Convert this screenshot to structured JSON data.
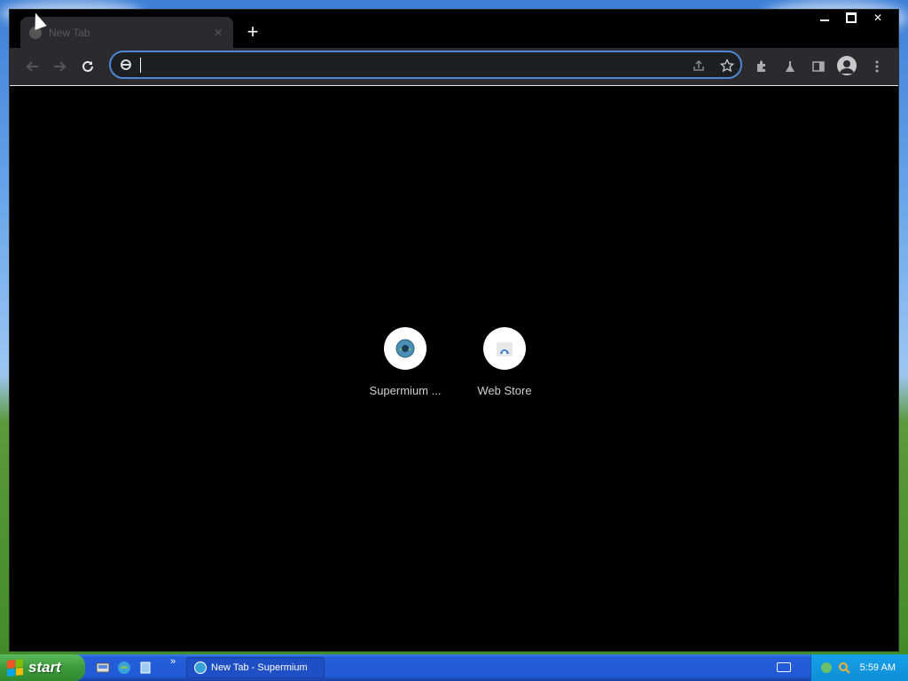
{
  "browser": {
    "tab": {
      "title": "New Tab",
      "close_icon": "close-icon"
    },
    "new_tab_label": "+",
    "window_controls": {
      "minimize": "",
      "maximize": "",
      "close": "✕"
    },
    "omnibox": {
      "value": "",
      "placeholder": ""
    },
    "shortcuts": [
      {
        "label": "Supermium ...",
        "icon": "supermium-icon"
      },
      {
        "label": "Web Store",
        "icon": "web-store-icon"
      }
    ],
    "accent_color": "#4e86d8",
    "background_color": "#000000"
  },
  "taskbar": {
    "start_label": "start",
    "quick_launch_more": "»",
    "active_window_label": "New Tab - Supermium",
    "clock": "5:59 AM"
  }
}
